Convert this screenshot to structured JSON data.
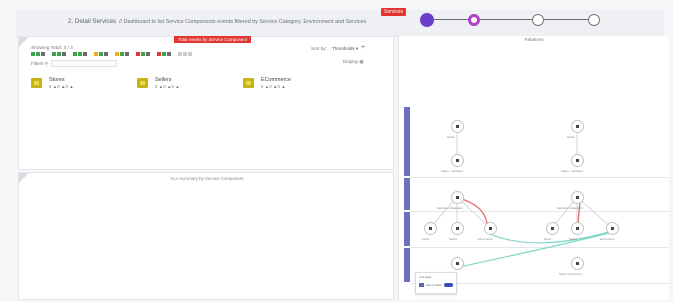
{
  "header": {
    "title": "2. Detail Services",
    "subtitle": "// Dashboard to list Service Components events filtered by Service Category, Environment and Services",
    "stage_badge": "Services"
  },
  "stepper": {
    "steps": [
      {
        "state": "complete",
        "color": "#6a3fc8"
      },
      {
        "state": "current",
        "color": "#b13fc8"
      },
      {
        "state": "pending",
        "color": "#ffffff"
      },
      {
        "state": "pending",
        "color": "#ffffff"
      }
    ]
  },
  "components_panel": {
    "tag": "Total events by Service Component",
    "showing": "Showing Total: 3 / 3",
    "sort_label": "Sort by:",
    "sort_value": "Thresholds",
    "display_label": "Display",
    "filters_label": "Filters",
    "chips": [
      {
        "colors": [
          "#3fa34d",
          "#3fa34d",
          "#6b6b6b"
        ]
      },
      {
        "colors": [
          "#3fa34d",
          "#3fa34d",
          "#6b6b6b"
        ]
      },
      {
        "colors": [
          "#3fa34d",
          "#3fa34d",
          "#6b6b6b"
        ]
      },
      {
        "colors": [
          "#e6b417",
          "#3fa34d",
          "#6b6b6b"
        ]
      },
      {
        "colors": [
          "#e6b417",
          "#3fa34d",
          "#6b6b6b"
        ]
      },
      {
        "colors": [
          "#e3342f",
          "#3fa34d",
          "#6b6b6b"
        ]
      },
      {
        "colors": [
          "#e3342f",
          "#3fa34d",
          "#6b6b6b"
        ]
      },
      {
        "colors": [
          "#cccccc",
          "#cccccc",
          "#cccccc"
        ]
      }
    ],
    "components": [
      {
        "name": "Stores",
        "stats": "0 ▲0 ▲0 ▲"
      },
      {
        "name": "Sellers",
        "stats": "0 ▲0 ▲0 ▲"
      },
      {
        "name": "ECommerce",
        "stats": "0 ▲0 ▲0 ▲"
      }
    ]
  },
  "summary_panel": {
    "title": "SLA summary by Service Component"
  },
  "relations": {
    "title": "Relations",
    "node_labels": [
      "Stores",
      "Stores",
      "Sellers",
      "Sellers",
      "Sellers · Catalogue",
      "Sellers · Catalogue",
      "Mainframe (Database)",
      "Mainframe (Database)",
      "Stores",
      "Sellers",
      "ECommerce",
      "Stores",
      "Sellers",
      "ECommerce",
      "Users",
      "Sellers (Consumers)"
    ],
    "legend_title": "Link types",
    "legend_text": "Has a relation"
  },
  "colors": {
    "accent_red": "#e3342f",
    "lane_purple": "#6f6fc1",
    "link_red": "#e57373",
    "link_teal": "#7fd8c6",
    "folder_gold": "#c7b316"
  }
}
